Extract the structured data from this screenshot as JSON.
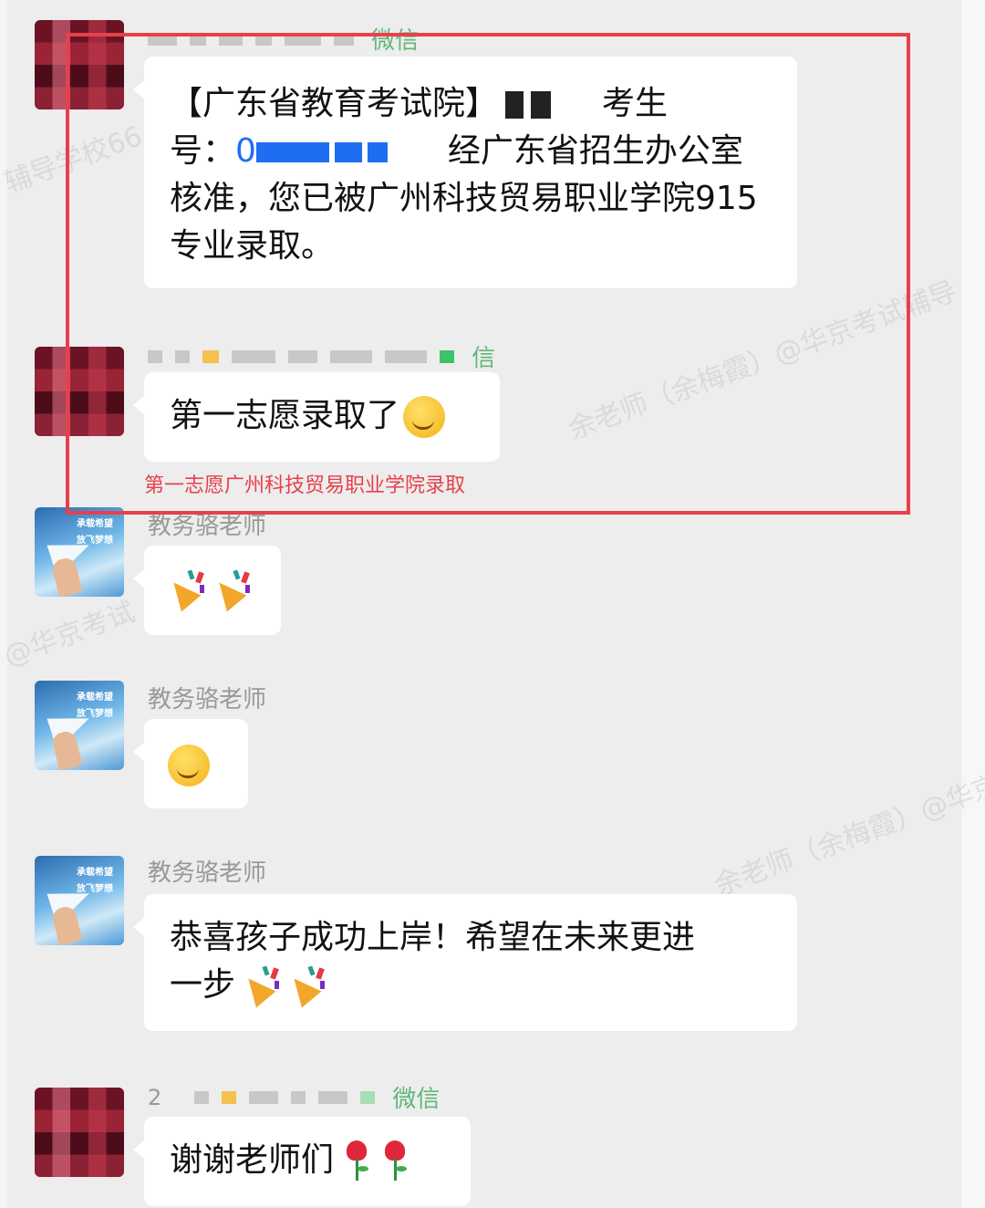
{
  "messages": [
    {
      "sender_badge": "微信",
      "text_parts": [
        "【广东省教育考试院】",
        "考生",
        "号：",
        "0",
        "经广东省招生办公室核准，您已被广州科技贸易职业学院915专业录取。"
      ]
    },
    {
      "sender_badge": "信",
      "text": "第一志愿录取了",
      "emoji": "hand-over-mouth-face-emoji"
    },
    {
      "sender": "教务骆老师",
      "emoji": "party-popper-emoji"
    },
    {
      "sender": "教务骆老师",
      "emoji": "smirking-face-emoji"
    },
    {
      "sender": "教务骆老师",
      "text_line1": "恭喜孩子成功上岸！希望在未来更进",
      "text_line2": "一步",
      "emoji": "party-popper-emoji"
    },
    {
      "sender_prefix": "2",
      "sender_badge": "微信",
      "text": "谢谢老师们",
      "emoji": "rose-emoji"
    }
  ],
  "annotation": {
    "caption": "第一志愿广州科技贸易职业学院录取",
    "color": "#e8404a"
  },
  "avatar_texts": [
    "承载希望",
    "放飞梦想"
  ],
  "watermarks": [
    "余老师（余梅霞）@华京考试辅导",
    "余老师（余梅霞）@华京考试辅导",
    "@华京考试",
    "辅导学校66"
  ],
  "colors": {
    "background": "#ededed",
    "bubble": "#ffffff",
    "wechat_green": "#5fb878",
    "mask_blue": "#1f6ef2"
  }
}
